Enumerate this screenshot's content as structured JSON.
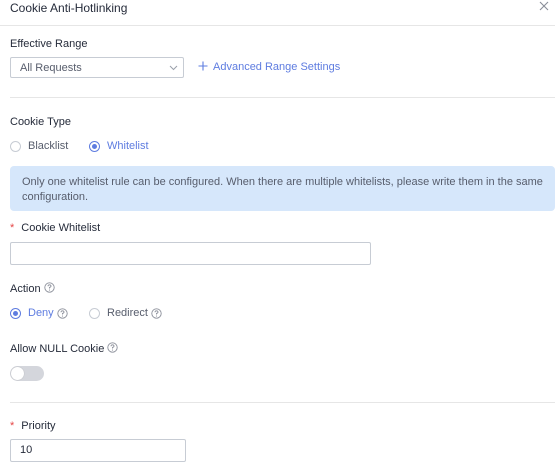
{
  "dialog": {
    "title": "Cookie Anti-Hotlinking"
  },
  "effective_range": {
    "label": "Effective Range",
    "selected": "All Requests",
    "advanced_link": "Advanced Range Settings"
  },
  "cookie_type": {
    "label": "Cookie Type",
    "options": [
      {
        "label": "Blacklist",
        "selected": false
      },
      {
        "label": "Whitelist",
        "selected": true
      }
    ],
    "info": "Only one whitelist rule can be configured. When there are multiple whitelists, please write them in the same configuration."
  },
  "cookie_whitelist": {
    "required_mark": "*",
    "label": "Cookie Whitelist",
    "value": ""
  },
  "action": {
    "label": "Action",
    "options": [
      {
        "label": "Deny",
        "selected": true
      },
      {
        "label": "Redirect",
        "selected": false
      }
    ]
  },
  "allow_null_cookie": {
    "label": "Allow NULL Cookie",
    "enabled": false
  },
  "priority": {
    "required_mark": "*",
    "label": "Priority",
    "value": "10"
  },
  "colors": {
    "accent": "#5e7ce0",
    "info_bg": "#d6e7fb",
    "required": "#e54545",
    "toggle_off": "#d4d6dc"
  },
  "icons": [
    "close-icon",
    "chevron-down-icon",
    "plus-icon",
    "help-icon"
  ]
}
